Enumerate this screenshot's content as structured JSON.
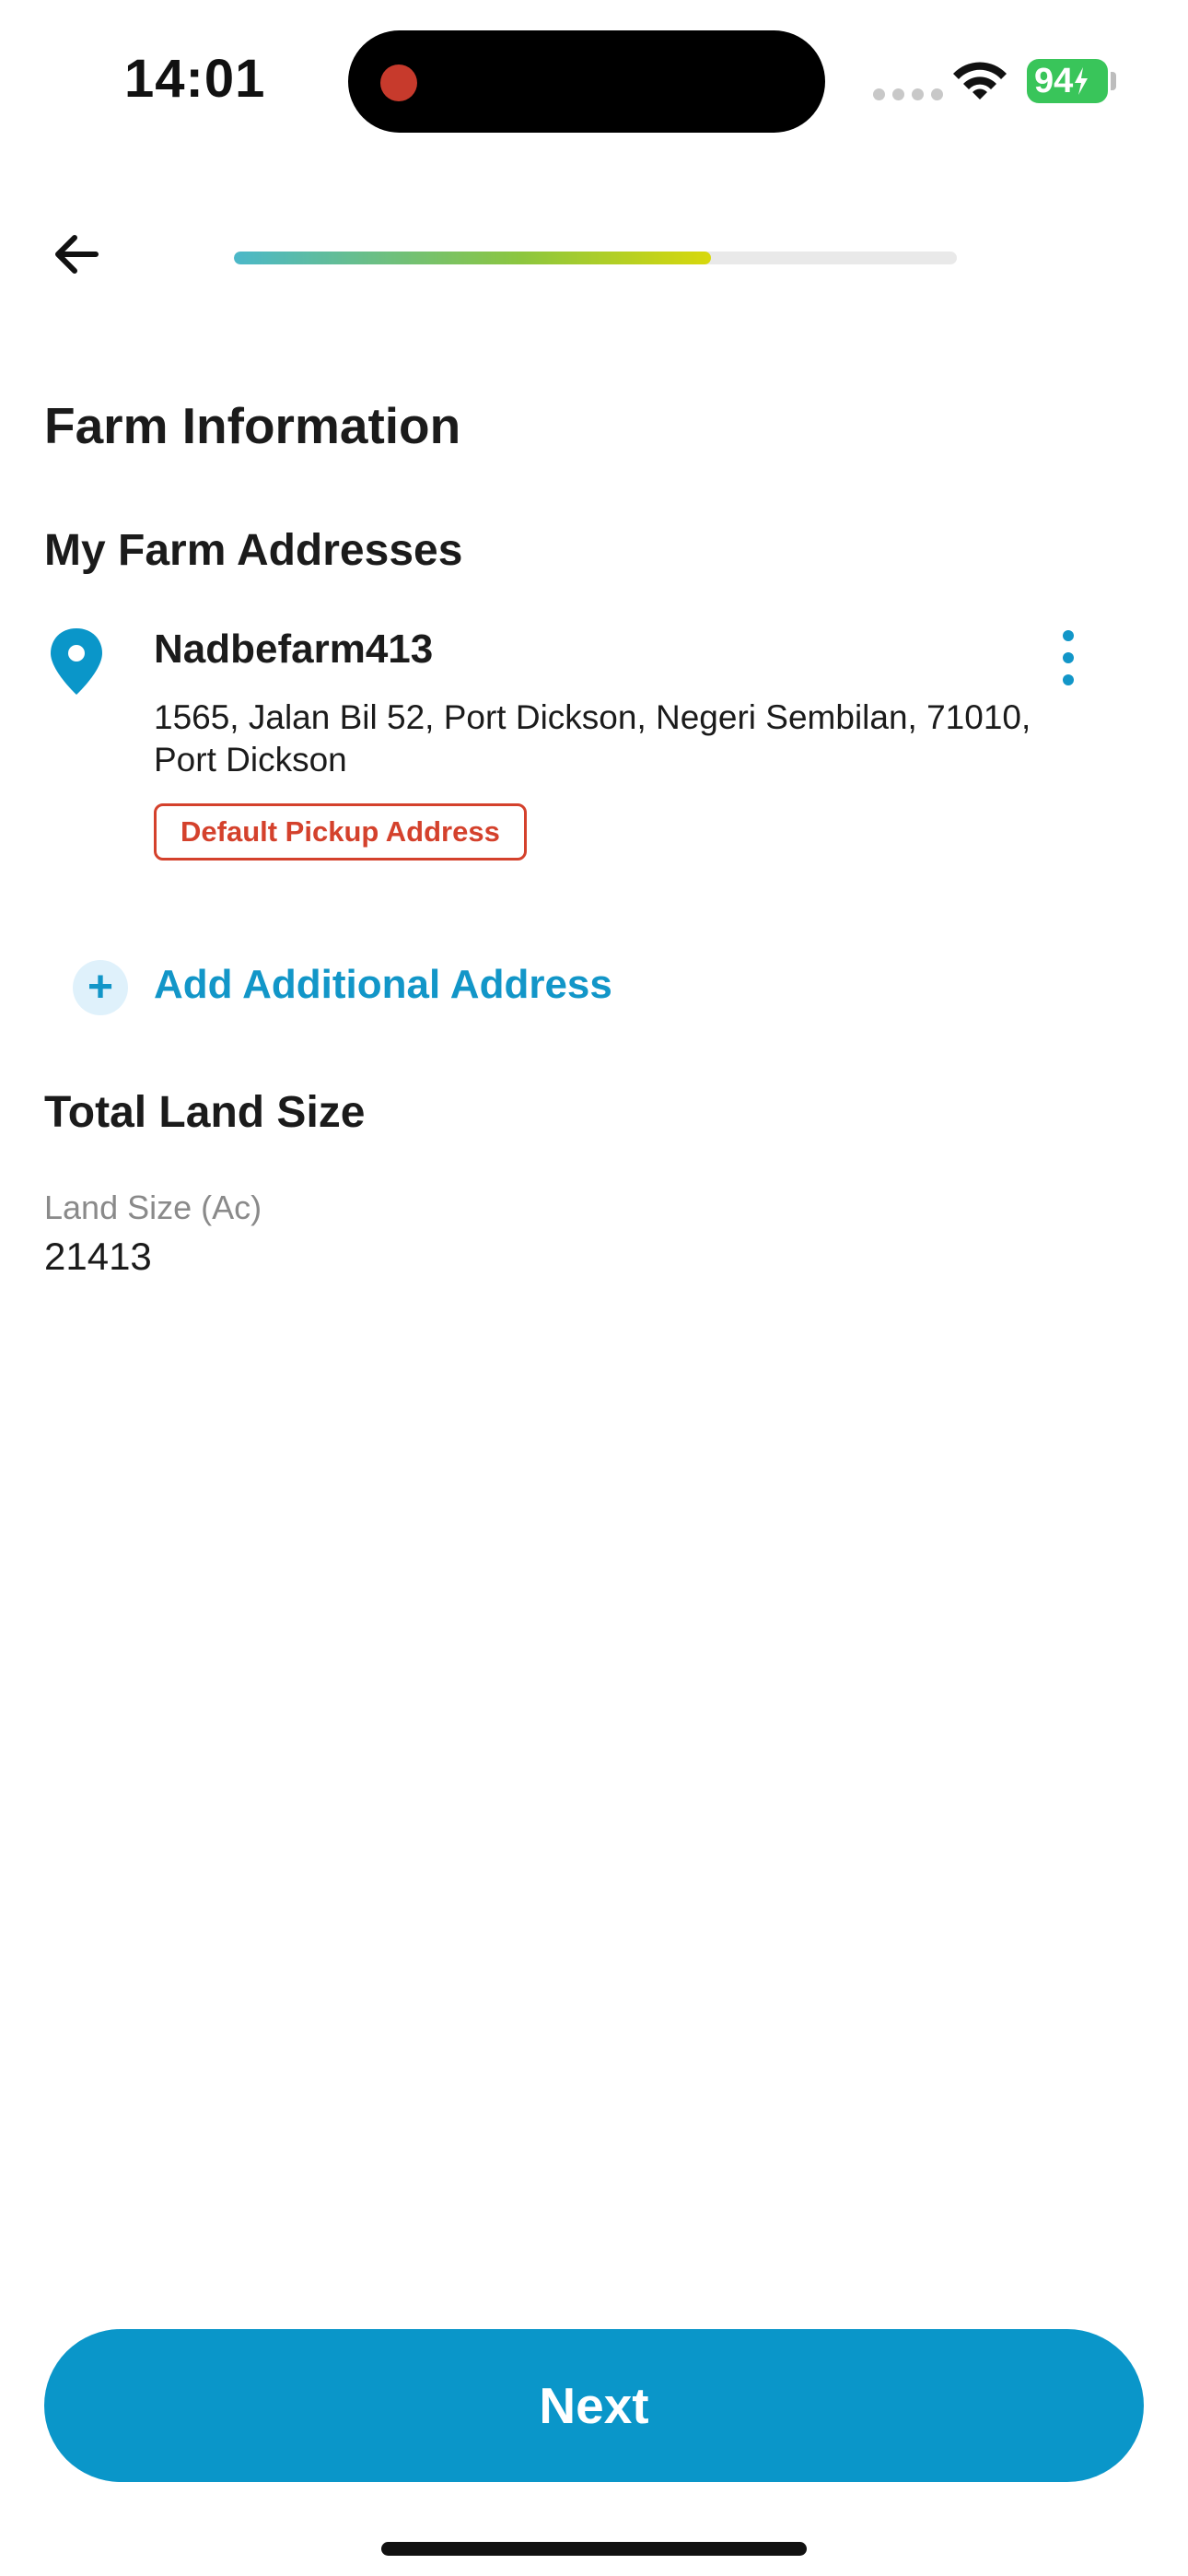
{
  "status_bar": {
    "time": "14:01",
    "battery": "94"
  },
  "header": {
    "progress_percent": 66
  },
  "page": {
    "title": "Farm Information"
  },
  "addresses": {
    "section_title": "My Farm Addresses",
    "items": [
      {
        "name": "Nadbefarm413",
        "address": "1565, Jalan Bil 52, Port Dickson, Negeri Sembilan, 71010, Port Dickson",
        "badge": "Default Pickup Address"
      }
    ],
    "add_label": "Add Additional Address"
  },
  "land": {
    "section_title": "Total Land Size",
    "field_label": "Land Size (Ac)",
    "field_value": "21413"
  },
  "footer": {
    "next_label": "Next"
  },
  "colors": {
    "accent": "#0a96c9",
    "badge": "#d4412c",
    "battery": "#39c55a"
  }
}
